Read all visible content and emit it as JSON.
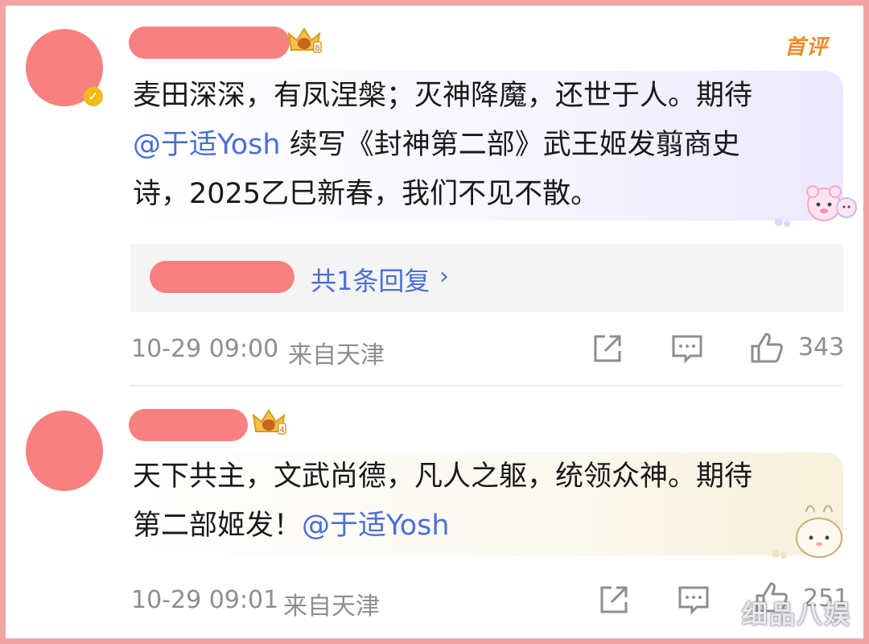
{
  "comments": [
    {
      "badge_label": "首评",
      "text_line1": "麦田深深，有凤涅槃；灭神降魔，还世于人。期待",
      "mention": "@于适Yosh",
      "text_line2_rest": " 续写《封神第二部》武王姬发翦商史",
      "text_line3": "诗，2025乙巳新春，我们不见不散。",
      "reply_summary": "共1条回复",
      "timestamp": "10-29 09:00",
      "location": "来自天津",
      "like_count": "343",
      "crown_level": "8"
    },
    {
      "text_line1": "天下共主，文武尚德，凡人之躯，统领众神。期待",
      "text_line2_start": "第二部姬发！",
      "mention": "@于适Yosh",
      "timestamp": "10-29 09:01",
      "location": "来自天津",
      "like_count": "251",
      "crown_level": "4"
    }
  ],
  "watermark": "细品八娱",
  "colors": {
    "redaction": "#f98080",
    "mention": "#4a6fd8",
    "meta_text": "#8e8e8e",
    "first_badge": "#f08a24",
    "frame": "#f2a3a6"
  },
  "icons": [
    "verified-badge-icon",
    "crown-badge-icon",
    "share-icon",
    "comment-icon",
    "like-icon",
    "chevron-right-icon"
  ]
}
